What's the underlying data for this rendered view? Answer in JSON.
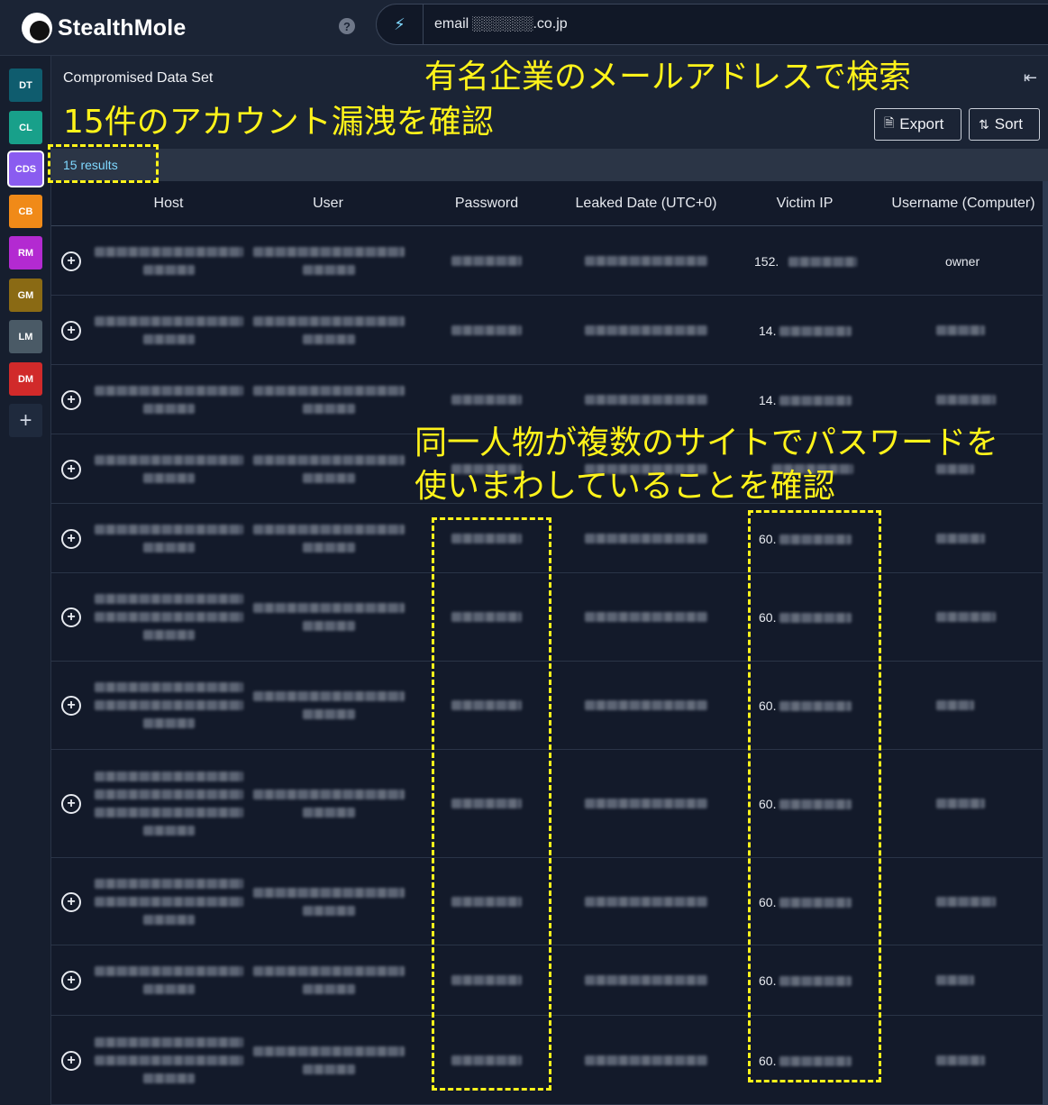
{
  "app": {
    "name": "StealthMole"
  },
  "search": {
    "query": "email ░░░░░░.co.jp"
  },
  "rail": {
    "items": [
      {
        "label": "DT",
        "color": "#0f5c6e"
      },
      {
        "label": "CL",
        "color": "#18a08a"
      },
      {
        "label": "CDS",
        "color": "#8a5cf0"
      },
      {
        "label": "CB",
        "color": "#f08a18"
      },
      {
        "label": "RM",
        "color": "#b32ad1"
      },
      {
        "label": "GM",
        "color": "#8a6a14"
      },
      {
        "label": "LM",
        "color": "#4a5a66"
      },
      {
        "label": "DM",
        "color": "#d12a2a"
      }
    ],
    "add_icon": "+"
  },
  "panel": {
    "title": "Compromised Data Set",
    "export_label": "Export",
    "sort_label": "Sort",
    "results": "15 results"
  },
  "table": {
    "headers": [
      "Host",
      "User",
      "Password",
      "Leaked Date (UTC+0)",
      "Victim IP",
      "Username (Computer)"
    ],
    "visible_cells": {
      "row1_ip_prefix": "152.",
      "row1_username": "owner",
      "row2_ip_prefix": "14.",
      "row3_ip_prefix": "14.",
      "row5_ip_prefix": "60.",
      "row6_ip_prefix": "60.",
      "row7_ip_prefix": "60.",
      "row8_ip_prefix": "60.",
      "row9_ip_prefix": "60.",
      "row10_ip_prefix": "60.",
      "row11_ip_prefix": "60."
    }
  },
  "annotations": {
    "search_note": "有名企業のメールアドレスで検索",
    "count_note": "15件のアカウント漏洩を確認",
    "reuse_note_line1": "同一人物が複数のサイトでパスワードを",
    "reuse_note_line2": "使いまわしていることを確認"
  }
}
